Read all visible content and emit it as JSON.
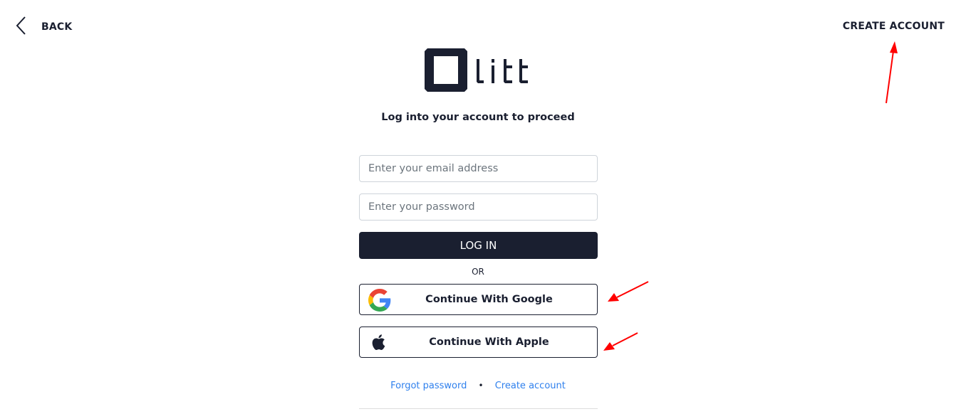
{
  "nav": {
    "back_label": "BACK",
    "back_icon": "chevron-left-icon",
    "create_account_label": "CREATE ACCOUNT"
  },
  "logo": {
    "text": "litt",
    "color": "#1a1f30"
  },
  "heading": "Log into your account to proceed",
  "form": {
    "email": {
      "value": "",
      "placeholder": "Enter your email address"
    },
    "password": {
      "value": "",
      "placeholder": "Enter your password"
    },
    "login_label": "LOG IN",
    "separator": "OR"
  },
  "social": {
    "google": {
      "label": "Continue With Google",
      "icon": "google-icon"
    },
    "apple": {
      "label": "Continue With Apple",
      "icon": "apple-icon"
    }
  },
  "footer": {
    "forgot_password": "Forgot password",
    "separator": "•",
    "create_account": "Create account",
    "link_color": "#2f80ed"
  },
  "annotations": {
    "arrow_color": "#ff0000",
    "arrows": [
      "create-account-top",
      "continue-with-google",
      "continue-with-apple"
    ]
  },
  "colors": {
    "primary": "#1a1f30",
    "input_border": "#ced4da",
    "background": "#ffffff"
  }
}
